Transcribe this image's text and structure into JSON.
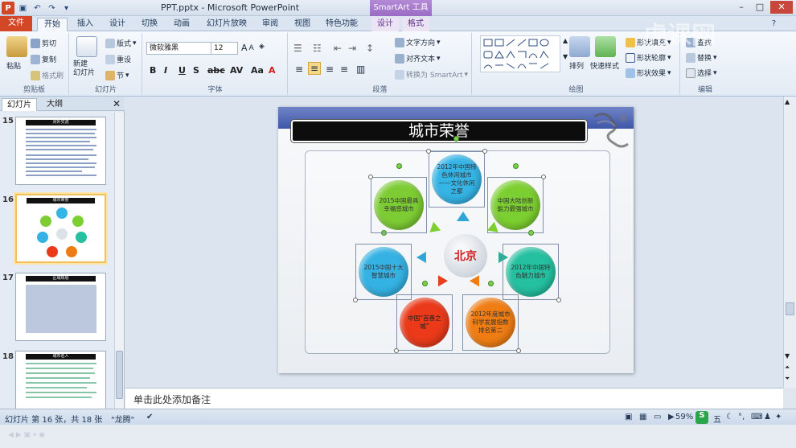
{
  "window": {
    "title": "PPT.pptx - Microsoft PowerPoint",
    "context_header": "SmartArt 工具"
  },
  "tabs": [
    "文件",
    "开始",
    "插入",
    "设计",
    "切换",
    "动画",
    "幻灯片放映",
    "审阅",
    "视图",
    "特色功能",
    "设计",
    "格式"
  ],
  "ribbon": {
    "clipboard": {
      "label": "剪贴板",
      "paste": "粘贴",
      "cut": "剪切",
      "copy": "复制",
      "format_painter": "格式刷"
    },
    "slides": {
      "label": "幻灯片",
      "new_slide": "新建\n幻灯片",
      "layout": "版式",
      "reset": "重设",
      "section": "节"
    },
    "font": {
      "label": "字体",
      "font_name": "微软雅黑",
      "font_size": "12"
    },
    "paragraph": {
      "label": "段落",
      "text_direction": "文字方向",
      "align_text": "对齐文本",
      "convert_smartart": "转换为 SmartArt"
    },
    "drawing": {
      "label": "绘图",
      "arrange": "排列",
      "quick_styles": "快速样式",
      "shape_fill": "形状填充",
      "shape_outline": "形状轮廓",
      "shape_effects": "形状效果"
    },
    "editing": {
      "label": "编辑",
      "find": "查找",
      "replace": "替换",
      "select": "选择"
    }
  },
  "panel": {
    "tabs": [
      "幻灯片",
      "大纲"
    ],
    "slides": [
      {
        "num": "15",
        "title": "对外交流"
      },
      {
        "num": "16",
        "title": "城市荣誉"
      },
      {
        "num": "17",
        "title": "区域规划"
      },
      {
        "num": "18",
        "title": "城市名人"
      }
    ]
  },
  "slide": {
    "title": "城市荣誉",
    "center": "北京",
    "circles": [
      {
        "text": "2012年中国特色休闲城市——文化休闲之都",
        "color": "#35b4e6"
      },
      {
        "text": "中国大陆创新能力最强城市",
        "color": "#7ccf30"
      },
      {
        "text": "2012年中国特色魅力城市",
        "color": "#24c0a0"
      },
      {
        "text": "2012年度城市科学发展指数排名第二",
        "color": "#f07d14"
      },
      {
        "text": "中国“首善之城”",
        "color": "#ea3a1a"
      },
      {
        "text": "2015中国十大智慧城市",
        "color": "#34b2e4"
      },
      {
        "text": "2015中国最具幸福感城市",
        "color": "#7dcc34"
      }
    ]
  },
  "notes_placeholder": "单击此处添加备注",
  "status": {
    "slide_info": "幻灯片 第 16 张，共 18 张",
    "theme": "\"龙腾\"",
    "zoom": "59%",
    "ime": "五"
  },
  "watermark": "虎课网"
}
